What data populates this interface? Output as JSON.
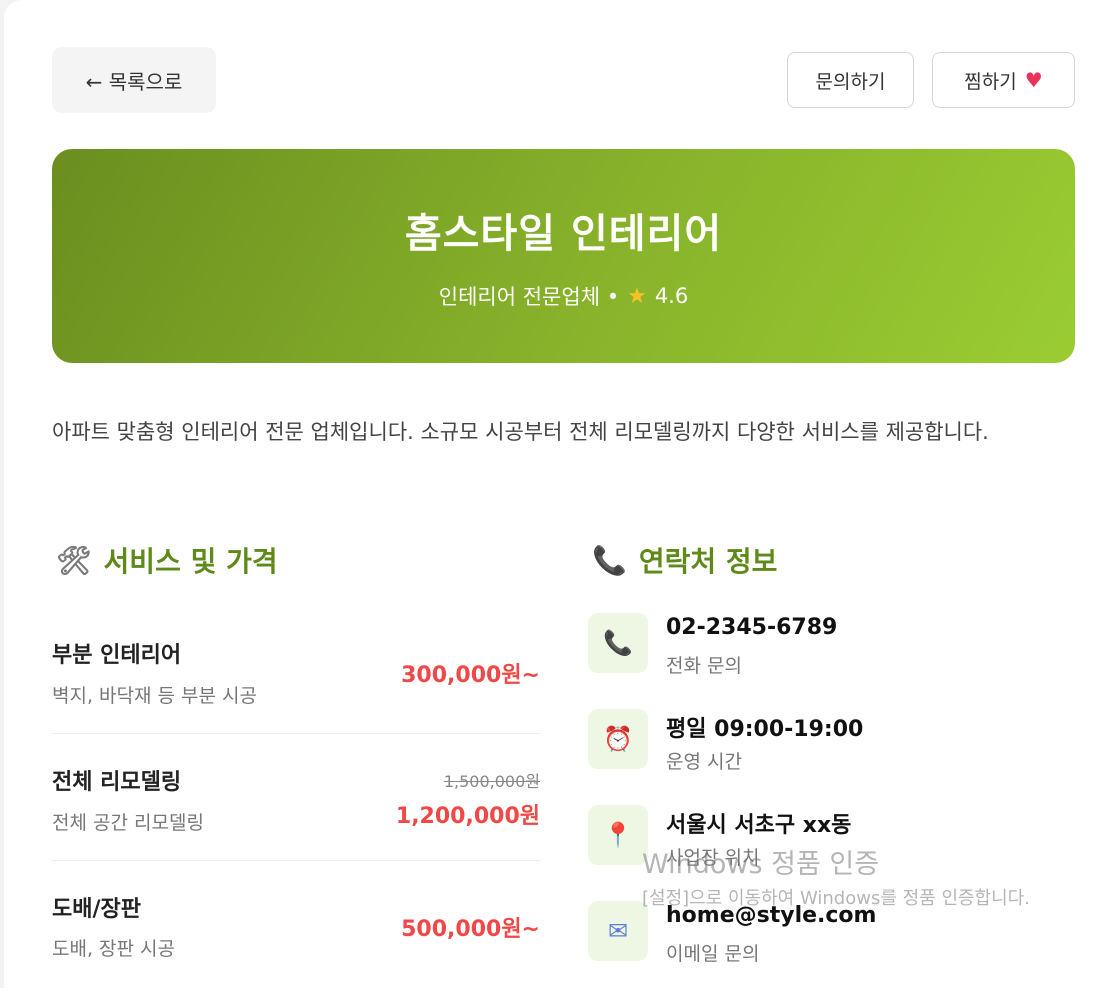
{
  "nav": {
    "back_label": "← 목록으로",
    "inquiry_label": "문의하기",
    "favorite_label": "찜하기"
  },
  "hero": {
    "title": "홈스타일 인테리어",
    "category": "인테리어 전문업체 •",
    "rating": "4.6"
  },
  "description": "아파트 맞춤형 인테리어 전문 업체입니다. 소규모 시공부터 전체 리모델링까지 다양한 서비스를 제공합니다.",
  "services": {
    "title": "서비스 및 가격",
    "items": [
      {
        "name": "부분 인테리어",
        "desc": "벽지, 바닥재 등 부분 시공",
        "price": "300,000원~",
        "original_price": ""
      },
      {
        "name": "전체 리모델링",
        "desc": "전체 공간 리모델링",
        "price": "1,200,000원",
        "original_price": "1,500,000원"
      },
      {
        "name": "도배/장판",
        "desc": "도배, 장판 시공",
        "price": "500,000원~",
        "original_price": ""
      }
    ]
  },
  "contact": {
    "title": "연락처 정보",
    "items": [
      {
        "main": "02-2345-6789",
        "sub": "전화 문의",
        "icon": "phone-icon"
      },
      {
        "main": "평일 09:00-19:00",
        "sub": "운영 시간",
        "icon": "alarm-clock-icon"
      },
      {
        "main": "서울시 서초구 xx동",
        "sub": "사업장 위치",
        "icon": "pin-icon"
      },
      {
        "main": "home@style.com",
        "sub": "이메일 문의",
        "icon": "email-icon"
      }
    ]
  },
  "watermark": {
    "title": "Windows 정품 인증",
    "subtitle": "[설정]으로 이동하여 Windows를 정품 인증합니다."
  },
  "colors": {
    "accent": "#5f8a1a",
    "price": "#f04747",
    "hero_start": "#6b8e1f",
    "hero_end": "#9acd32"
  }
}
